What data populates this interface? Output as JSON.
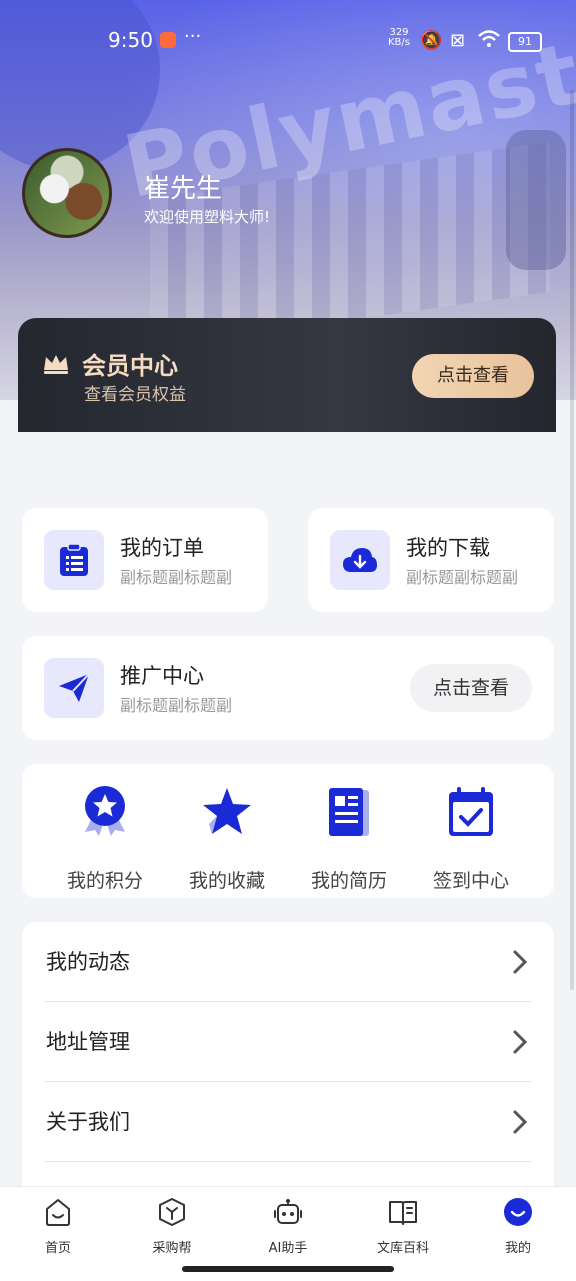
{
  "status_bar": {
    "time": "9:50",
    "dots": "···",
    "speed": "329\nKB/s",
    "battery": "91"
  },
  "header": {
    "watermark": "Polymaster",
    "user_name": "崔先生",
    "welcome": "欢迎使用塑料大师!"
  },
  "member_card": {
    "title": "会员中心",
    "desc": "查看会员权益",
    "button": "点击查看"
  },
  "quick_cards": [
    {
      "title": "我的订单",
      "subtitle": "副标题副标题副"
    },
    {
      "title": "我的下载",
      "subtitle": "副标题副标题副"
    }
  ],
  "promo_card": {
    "title": "推广中心",
    "subtitle": "副标题副标题副",
    "button": "点击查看"
  },
  "grid": [
    {
      "label": "我的积分",
      "icon": "medal-icon"
    },
    {
      "label": "我的收藏",
      "icon": "star-icon"
    },
    {
      "label": "我的简历",
      "icon": "resume-icon"
    },
    {
      "label": "签到中心",
      "icon": "calendar-check-icon"
    }
  ],
  "menu": [
    {
      "label": "我的动态"
    },
    {
      "label": "地址管理"
    },
    {
      "label": "关于我们"
    }
  ],
  "tabbar": [
    {
      "label": "首页",
      "icon": "home-icon"
    },
    {
      "label": "采购帮",
      "icon": "box-icon"
    },
    {
      "label": "AI助手",
      "icon": "robot-icon"
    },
    {
      "label": "文库百科",
      "icon": "book-icon"
    },
    {
      "label": "我的",
      "icon": "profile-icon",
      "active": true
    }
  ],
  "colors": {
    "accent": "#1a2ad6",
    "icon_bg": "#e7e8fb",
    "gold": "#f2d5b4"
  }
}
